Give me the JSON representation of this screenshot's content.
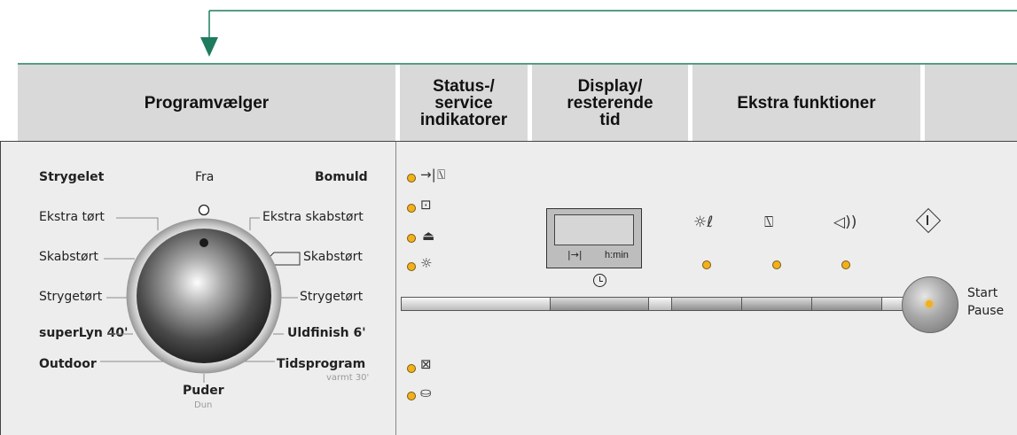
{
  "headers": {
    "programvaelger": "Programvælger",
    "status": "Status-/ service indikatorer",
    "display": "Display/ resterende tid",
    "ekstra": "Ekstra funktioner"
  },
  "dial": {
    "labels": {
      "strygelet": "Strygelet",
      "fra": "Fra",
      "bomuld": "Bomuld",
      "ekstra_tort": "Ekstra tørt",
      "ekstra_skabstort": "Ekstra skabstørt",
      "skabstort_left": "Skabstørt",
      "skabstort_right": "Skabstørt",
      "strygetort_left": "Strygetørt",
      "strygetort_right": "Strygetørt",
      "superlyn": "superLyn 40'",
      "uldfinish": "Uldfinish 6'",
      "outdoor": "Outdoor",
      "tidsprogram": "Tidsprogram",
      "tidsprogram_sub": "varmt 30'",
      "puder": "Puder",
      "puder_sub": "Dun"
    }
  },
  "display": {
    "end_symbol": "|→|",
    "time_format": "h:min"
  },
  "start": {
    "label_start": "Start",
    "label_pause": "Pause"
  },
  "colors": {
    "arrow": "#1e7b5e",
    "led": "#f2b11c",
    "header_bg": "#d9d9d9",
    "panel_bg": "#ededed"
  }
}
